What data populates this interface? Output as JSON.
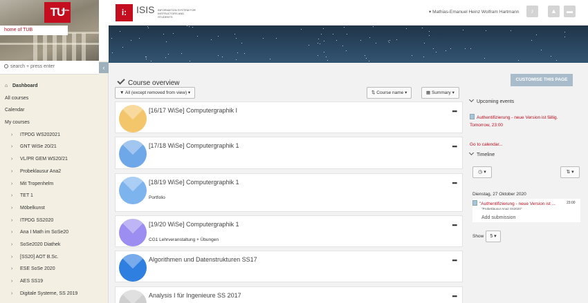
{
  "sidebar": {
    "home_link": "home of TUB",
    "logo_text": "TU",
    "logo_sub": "berlin",
    "search_placeholder": "search + press enter",
    "collapse_icon": "‹",
    "items": [
      {
        "label": "Dashboard",
        "active": true,
        "indent": 0,
        "icon": "home-icon"
      },
      {
        "label": "All courses",
        "indent": 0
      },
      {
        "label": "Calendar",
        "indent": 0
      },
      {
        "label": "My courses",
        "indent": 0
      },
      {
        "label": "ITPDG WS202021",
        "indent": 1
      },
      {
        "label": "GNT WiSe 20/21",
        "indent": 1
      },
      {
        "label": "VL/PR GEM WS20/21",
        "indent": 1
      },
      {
        "label": "Probeklausur Ana2",
        "indent": 1
      },
      {
        "label": "Mit Tropenhelm",
        "indent": 1
      },
      {
        "label": "TET 1",
        "indent": 1
      },
      {
        "label": "Möbelkunst",
        "indent": 1
      },
      {
        "label": "ITPDG SS2020",
        "indent": 1
      },
      {
        "label": "Ana I Math im SoSe20",
        "indent": 1
      },
      {
        "label": "SoSe2020 Diathek",
        "indent": 1
      },
      {
        "label": "[SS20] AOT B.Sc.",
        "indent": 1
      },
      {
        "label": "ESE SoSe 2020",
        "indent": 1
      },
      {
        "label": "AES SS19",
        "indent": 1
      },
      {
        "label": "Digitale Systeme, SS 2019",
        "indent": 1
      }
    ]
  },
  "header": {
    "logo_text": "i:",
    "title": "ISIS",
    "subtitle": "INFORMATION SYSTEM FOR INSTRUCTORS AND STUDENTS",
    "user_name": "▾ Mathias-Emanuel Heinz Wolfram Hartmann"
  },
  "main": {
    "customise_label": "CUSTOMISE THIS PAGE",
    "overview_title": "Course overview",
    "filter_label": "All (except removed from view) ▾",
    "sort_label": "Course name ▾",
    "view_label": "Summary ▾",
    "courses": [
      {
        "name": "[16/17 WiSe] Computergraphik I",
        "desc": "",
        "color": "#f4c66b"
      },
      {
        "name": "[17/18 WiSe] Computergraphik 1",
        "desc": "",
        "color": "#6fa8e8"
      },
      {
        "name": "[18/19 WiSe] Computergraphik 1",
        "desc": "Portfolio",
        "color": "#7db4ee"
      },
      {
        "name": "[19/20 WiSe] Computergraphik 1",
        "desc": "CG1 Lehrveranstaltung + Übungen",
        "color": "#9b8ef0"
      },
      {
        "name": "Algorithmen und Datenstrukturen SS17",
        "desc": "",
        "color": "#2f7fe0"
      },
      {
        "name": "Analysis I für Ingenieure SS 2017",
        "desc": "",
        "color": "#cfcfcf"
      }
    ]
  },
  "upcoming": {
    "heading": "Upcoming events",
    "event_title": "Authentifizierung - neue Version ist fällig.",
    "event_time": "Tomorrow, 23:00",
    "calendar_link": "Go to calendar..."
  },
  "timeline": {
    "heading": "Timeline",
    "date": "Dienstag, 27 Oktober 2020",
    "event_title": "\"Authentifizierung - neue Version ist ...",
    "event_course": "\"Probeklausur Ana2 SS2020\"",
    "event_time": "23:00",
    "add_submission": "Add submission",
    "show_label": "Show",
    "show_value": "5 ▾"
  },
  "colors": {
    "brand_red": "#c40d1e",
    "customise_btn": "#a8bccb"
  }
}
